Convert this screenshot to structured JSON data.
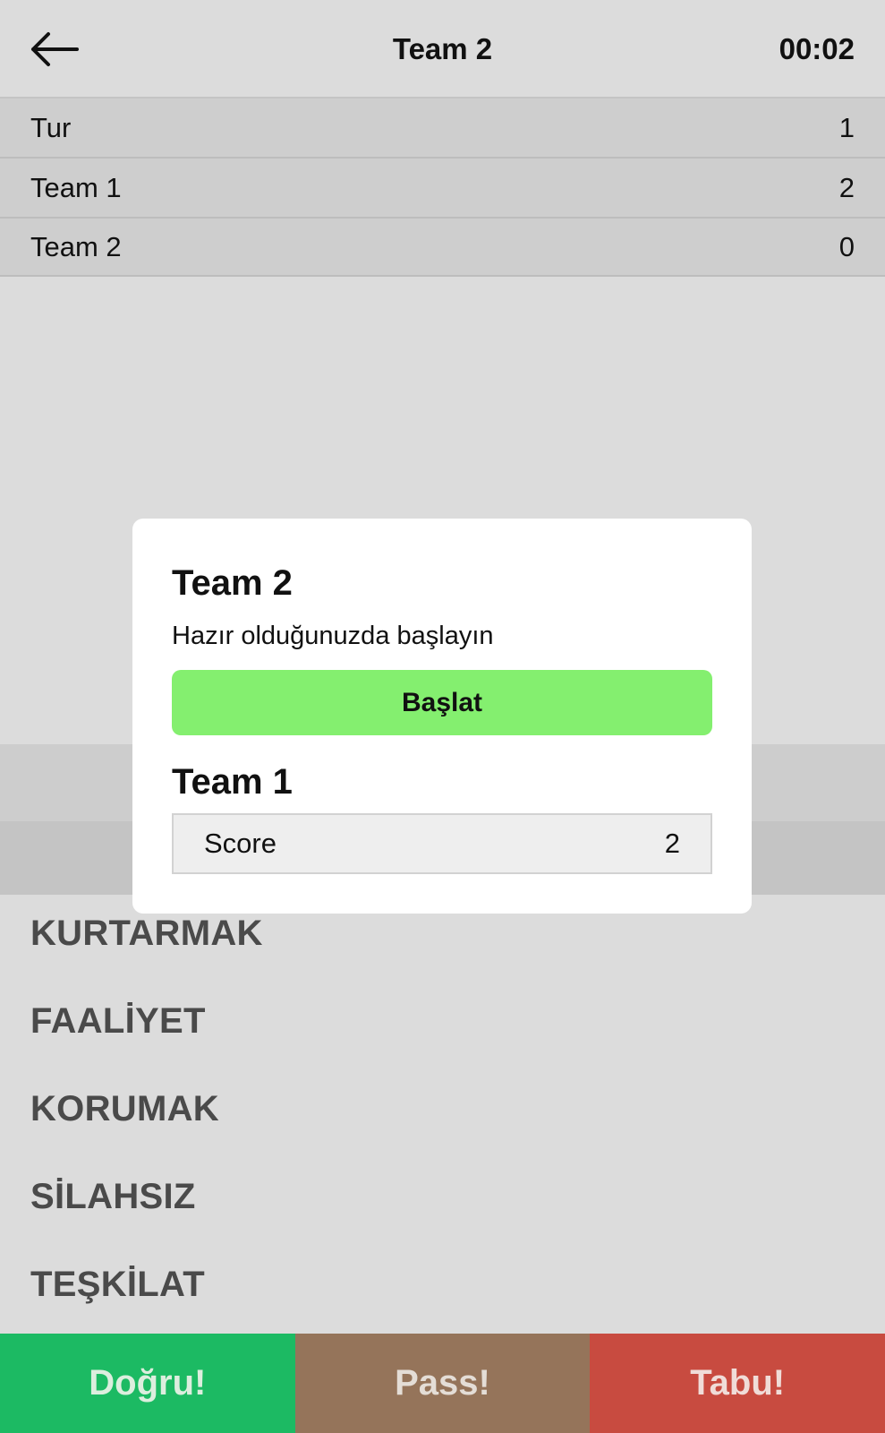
{
  "header": {
    "title": "Team 2",
    "timer": "00:02",
    "back_icon": "arrow-left-icon"
  },
  "scoreboard": {
    "rows": [
      {
        "label": "Tur",
        "value": "1"
      },
      {
        "label": "Team 1",
        "value": "2"
      },
      {
        "label": "Team 2",
        "value": "0"
      }
    ]
  },
  "words": [
    "KURTARMAK",
    "FAALİYET",
    "KORUMAK",
    "SİLAHSIZ",
    "TEŞKİLAT"
  ],
  "actions": {
    "correct": "Doğru!",
    "pass": "Pass!",
    "taboo": "Tabu!"
  },
  "modal": {
    "title": "Team 2",
    "subtitle": "Hazır olduğunuzda başlayın",
    "start_label": "Başlat",
    "previous_team": "Team 1",
    "score_label": "Score",
    "score_value": "2"
  },
  "colors": {
    "correct": "#1cba63",
    "pass": "#95745a",
    "taboo": "#c84b40",
    "start": "#84ef6f"
  }
}
